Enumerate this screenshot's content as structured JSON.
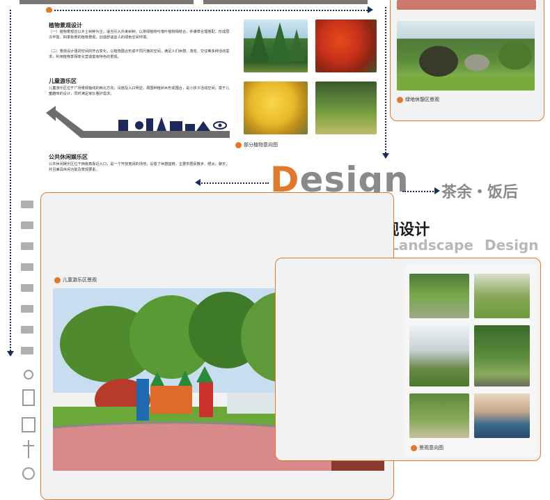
{
  "top_left_panel": {
    "section1_title": "植物景观设计",
    "section1_para1": "（一）植物景观应以乡土树种为主，适当引入外来树种，以常绿植物与落叶植物相结合，乔灌草合理搭配，形成层次丰富、四季有景的植物景观，创造舒适宜人的绿色空间环境。",
    "section1_para2": "（二）景观设计强调空间的开合变化，以植物围合形成不同尺度的空间，满足人们休憩、游览、交往等多种活动需求，利用植物季相变化营造富有特色的景观。",
    "section2_title": "儿童游乐区",
    "section2_para": "儿童游乐区位于广场景观轴线的西北方向，设施及入口明显，周围种植树木形成围合，是小孩子活动空间，富于儿童趣味的设计，同时满足家长看护需求。",
    "section3_title": "公共休闲娱乐区",
    "section3_para": "公共休闲娱乐区位于西南角靠近入口，是一个开放宽阔的场地，设置了休憩座椅，主要供居民散步、晒太、聊天，并且兼具休闲功能及景观要素。"
  },
  "plant_panel": {
    "caption": "部分植物意向图"
  },
  "green_rest_panel": {
    "caption": "绿地休憩区景观"
  },
  "title_block": {
    "design_D": "D",
    "design_rest": "esign",
    "tagline": "茶余・饭后",
    "subtitle": "×××广场・景观设计",
    "landscape_en": "Landscape",
    "design_en": "Design"
  },
  "kids_panel": {
    "caption": "儿童游乐区景观"
  },
  "landscape_panel": {
    "caption": "景观意向图"
  },
  "colors": {
    "accent": "#e07a2a",
    "navy": "#1b2a5a",
    "grey_text": "#8a8a8a",
    "panel_bg": "#f2f2f2"
  }
}
